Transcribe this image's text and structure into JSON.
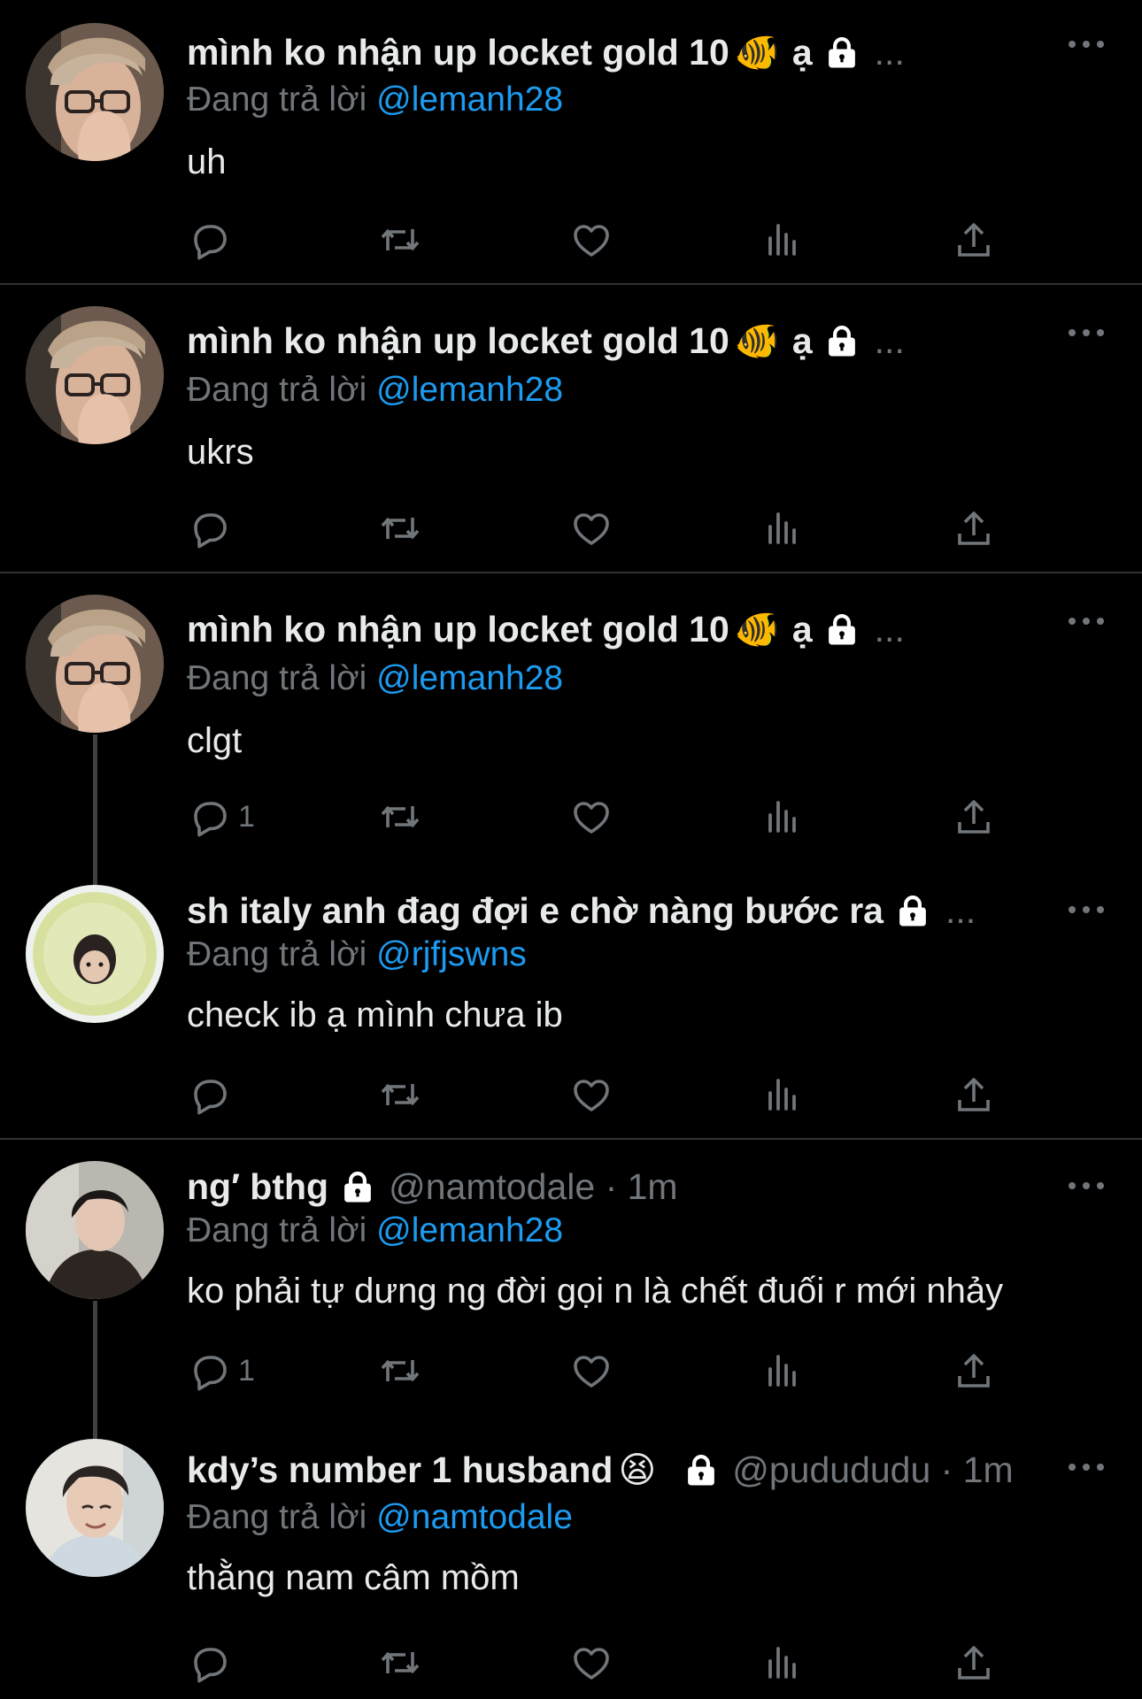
{
  "common": {
    "reply_prefix": "Đang trả lời",
    "ellipsis": "..."
  },
  "tweets": [
    {
      "name": "mình ko nhận up locket gold 10",
      "name_emoji": "🐠",
      "name_suffix": "ạ",
      "reply_to": "@lemanh28",
      "text": "uh",
      "reply_count": "",
      "avatar": "person-glasses"
    },
    {
      "name": "mình ko nhận up locket gold 10",
      "name_emoji": "🐠",
      "name_suffix": "ạ",
      "reply_to": "@lemanh28",
      "text": "ukrs",
      "reply_count": "",
      "avatar": "person-glasses"
    },
    {
      "name": "mình ko nhận up locket gold 10",
      "name_emoji": "🐠",
      "name_suffix": "ạ",
      "reply_to": "@lemanh28",
      "text": "clgt",
      "reply_count": "1",
      "avatar": "person-glasses"
    },
    {
      "name": "sh italy anh đag đợi e chờ nàng bước ra",
      "reply_to": "@rjfjswns",
      "text": "check ib ạ mình chưa ib",
      "reply_count": "",
      "avatar": "face-in-bread"
    },
    {
      "name": "ng′ bthg",
      "handle_time": "@namtodale · 1m",
      "reply_to": "@lemanh28",
      "text": "ko phải tự dưng ng đời gọi n là chết đuối r mới nhảy",
      "reply_count": "1",
      "avatar": "person-dark-jacket"
    },
    {
      "name": "kdy’s number 1 husband",
      "name_emoji": "😫",
      "handle_time": "@pudududu · 1m",
      "reply_to": "@namtodale",
      "text": "thằng nam câm mồm",
      "reply_count": "",
      "avatar": "person-smiling"
    }
  ],
  "colors": {
    "background": "#000000",
    "text": "#e7e9ea",
    "muted": "#71767b",
    "accent": "#1d9bf0",
    "divider": "#2f3336"
  },
  "icons": [
    "reply-icon",
    "retweet-icon",
    "like-icon",
    "views-icon",
    "share-icon",
    "lock-icon",
    "more-icon"
  ]
}
